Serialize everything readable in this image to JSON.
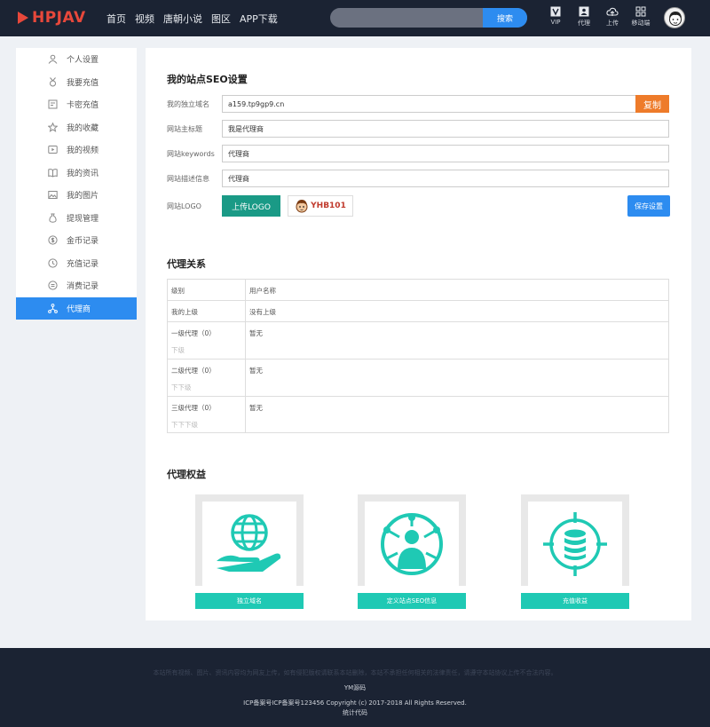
{
  "header": {
    "logo": "HPJAV",
    "nav": [
      "首页",
      "视频",
      "唐朝小说",
      "图区",
      "APP下载"
    ],
    "search_placeholder": "",
    "search_button": "搜索",
    "icons": [
      {
        "label": "VIP",
        "icon": "vip-icon"
      },
      {
        "label": "代理",
        "icon": "user-card-icon"
      },
      {
        "label": "上传",
        "icon": "upload-cloud-icon"
      },
      {
        "label": "移动端",
        "icon": "grid-icon"
      }
    ]
  },
  "sidebar": {
    "items": [
      {
        "label": "个人设置",
        "icon": "user-icon"
      },
      {
        "label": "我要充值",
        "icon": "medal-icon"
      },
      {
        "label": "卡密充值",
        "icon": "card-icon"
      },
      {
        "label": "我的收藏",
        "icon": "star-icon"
      },
      {
        "label": "我的视频",
        "icon": "video-icon"
      },
      {
        "label": "我的资讯",
        "icon": "book-icon"
      },
      {
        "label": "我的图片",
        "icon": "image-icon"
      },
      {
        "label": "提现管理",
        "icon": "money-bag-icon"
      },
      {
        "label": "金币记录",
        "icon": "coin-icon"
      },
      {
        "label": "充值记录",
        "icon": "clock-icon"
      },
      {
        "label": "消费记录",
        "icon": "receipt-icon"
      },
      {
        "label": "代理商",
        "icon": "network-icon"
      }
    ],
    "active_index": 11
  },
  "seo": {
    "title": "我的站点SEO设置",
    "domain_label": "我的独立域名",
    "domain_value": "a159.tp9gp9.cn",
    "copy_button": "复制",
    "site_title_label": "网站主标题",
    "site_title_value": "我是代理商",
    "keywords_label": "网站keywords",
    "keywords_value": "代理商",
    "description_label": "网站描述信息",
    "description_value": "代理商",
    "logo_label": "网站LOGO",
    "upload_button": "上传LOGO",
    "logo_preview_text": "YHB101",
    "save_button": "保存设置"
  },
  "agency": {
    "title": "代理关系",
    "headers": [
      "级别",
      "用户名称"
    ],
    "rows": [
      {
        "level": "我的上级",
        "sub": "",
        "value": "没有上级"
      },
      {
        "level": "一级代理（0）",
        "sub": "下级",
        "value": "暂无"
      },
      {
        "level": "二级代理（0）",
        "sub": "下下级",
        "value": "暂无"
      },
      {
        "level": "三级代理（0）",
        "sub": "下下下级",
        "value": "暂无"
      }
    ]
  },
  "benefits": {
    "title": "代理权益",
    "items": [
      {
        "label": "独立域名",
        "icon": "globe-hand-icon"
      },
      {
        "label": "定义站点SEO信息",
        "icon": "user-network-icon"
      },
      {
        "label": "充值收益",
        "icon": "database-target-icon"
      }
    ]
  },
  "footer": {
    "disclaimer": "本站所有视频、图片、资讯内容均为网友上传，如有侵犯版权请联系本站删除，本站不承担任何相关的法律责任，请遵守本站协议上传不合法内容。",
    "brand": "YM源码",
    "copyright": "ICP备案号ICP备案号123456   Copyright (c) 2017-2018 All Rights Reserved.",
    "stats": "统计代码"
  },
  "colors": {
    "header_bg": "#1b2333",
    "brand": "#e8483b",
    "primary": "#2d8cf0",
    "copy": "#ee7b2a",
    "teal": "#1a9a86",
    "benefit": "#1fc9b4"
  }
}
